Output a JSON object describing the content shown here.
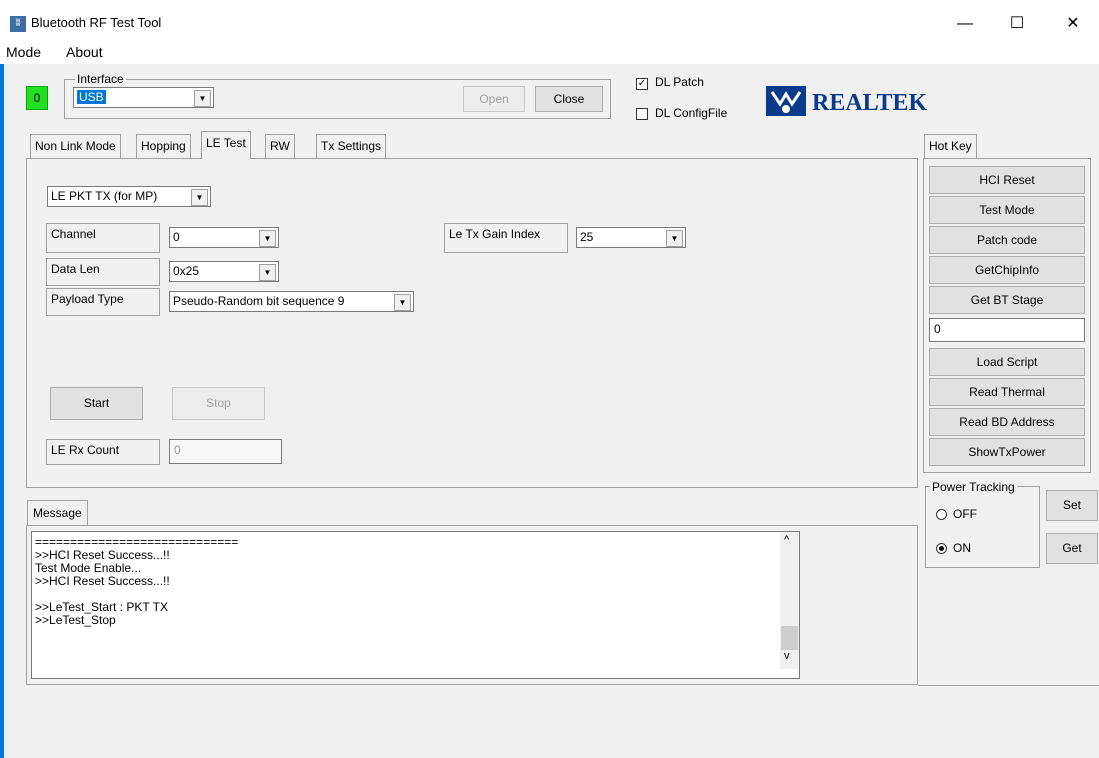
{
  "window": {
    "title": "Bluetooth RF Test Tool",
    "minimize": "—",
    "maximize": "☐",
    "close": "✕"
  },
  "menu": [
    "Mode",
    "About"
  ],
  "status_led": {
    "text": "0",
    "color": "#20e020"
  },
  "interface": {
    "legend": "Interface",
    "selected": "USB",
    "open_label": "Open",
    "close_label": "Close"
  },
  "options": {
    "dl_patch": {
      "label": "DL Patch",
      "checked": true
    },
    "dl_configfile": {
      "label": "DL ConfigFile",
      "checked": false
    }
  },
  "logo": {
    "text": "REALTEK",
    "color": "#0a3a8c"
  },
  "tabs": [
    {
      "label": "Non Link Mode",
      "active": false
    },
    {
      "label": "Hopping",
      "active": false
    },
    {
      "label": "LE Test",
      "active": true
    },
    {
      "label": "RW",
      "active": false
    },
    {
      "label": "Tx Settings",
      "active": false
    }
  ],
  "le_test": {
    "mode_selected": "LE PKT TX (for MP)",
    "channel_label": "Channel",
    "channel_value": "0",
    "data_len_label": "Data Len",
    "data_len_value": "0x25",
    "payload_type_label": "Payload Type",
    "payload_type_value": "Pseudo-Random bit sequence 9",
    "gain_label": "Le Tx Gain Index",
    "gain_value": "25",
    "start_label": "Start",
    "stop_label": "Stop",
    "rx_count_label": "LE Rx Count",
    "rx_count_value": "0"
  },
  "message": {
    "tab_label": "Message",
    "lines": "=============================\n>>HCI Reset Success...!!\nTest Mode Enable...\n>>HCI Reset Success...!!\n\n>>LeTest_Start : PKT TX\n>>LeTest_Stop"
  },
  "hotkey": {
    "tab_label": "Hot Key",
    "hci_reset": "HCI Reset",
    "test_mode": "Test Mode",
    "patch_code": "Patch code",
    "get_chip_info": "GetChipInfo",
    "get_bt_stage": "Get BT Stage",
    "stage_value": "0",
    "load_script": "Load Script",
    "read_thermal": "Read Thermal",
    "read_bd_address": "Read BD Address",
    "show_tx_power": "ShowTxPower"
  },
  "power_tracking": {
    "legend": "Power Tracking",
    "off_label": "OFF",
    "on_label": "ON",
    "selected": "ON",
    "set_label": "Set",
    "get_label": "Get"
  }
}
